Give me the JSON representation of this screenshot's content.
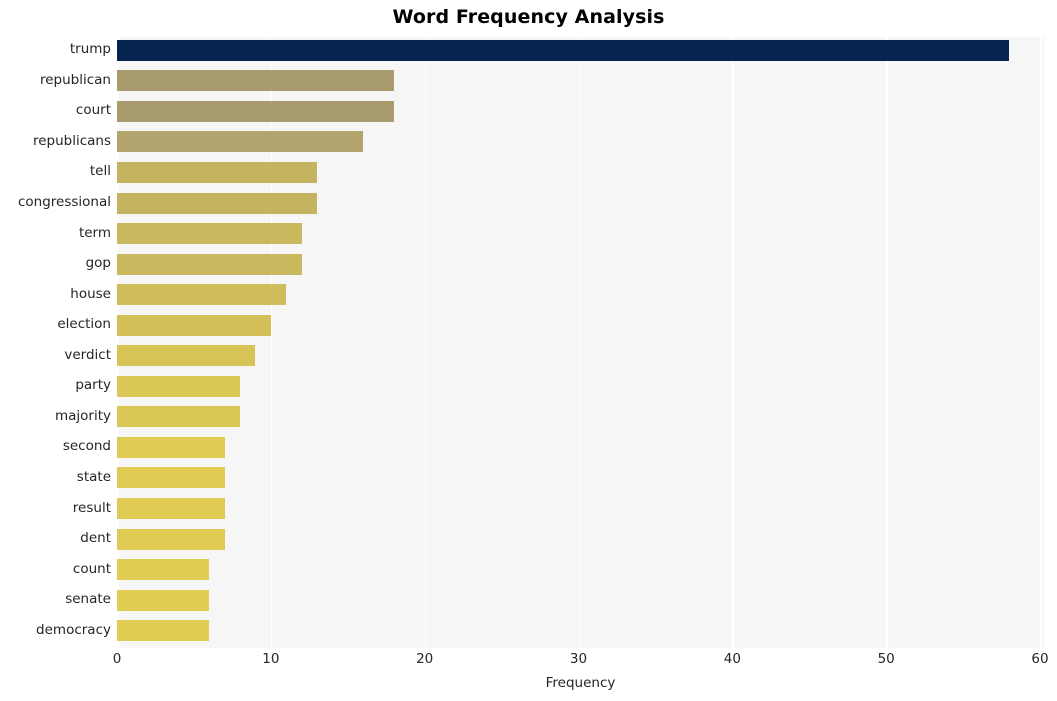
{
  "chart_data": {
    "type": "bar",
    "orientation": "horizontal",
    "title": "Word Frequency Analysis",
    "xlabel": "Frequency",
    "ylabel": "",
    "xlim": [
      0,
      60
    ],
    "xticks": [
      0,
      10,
      20,
      30,
      40,
      50,
      60
    ],
    "xtick_labels": [
      "0",
      "10",
      "20",
      "30",
      "40",
      "50",
      "60"
    ],
    "grid": "vertical-white-on-light-gray",
    "legend": "none",
    "categories": [
      "trump",
      "republican",
      "court",
      "republicans",
      "tell",
      "congressional",
      "term",
      "gop",
      "house",
      "election",
      "verdict",
      "party",
      "majority",
      "second",
      "state",
      "result",
      "dent",
      "count",
      "senate",
      "democracy"
    ],
    "values": [
      58,
      18,
      18,
      16,
      13,
      13,
      12,
      12,
      11,
      10,
      9,
      8,
      8,
      7,
      7,
      7,
      7,
      6,
      6,
      6
    ],
    "bar_colors": [
      "#06244f",
      "#a89c6e",
      "#a89c6e",
      "#b2a46c",
      "#c4b35f",
      "#c4b35f",
      "#c9b85d",
      "#c9b85d",
      "#cfbc5b",
      "#d3c058",
      "#d7c356",
      "#dbc755",
      "#dbc755",
      "#dfca54",
      "#dfca54",
      "#dfca54",
      "#dfca54",
      "#e1cd53",
      "#e1cd53",
      "#e1cd53"
    ],
    "plot_background": "#f6f6f7",
    "gridline_color": "#ffffff",
    "figure_background": "#ffffff",
    "text_color": "#262626"
  }
}
